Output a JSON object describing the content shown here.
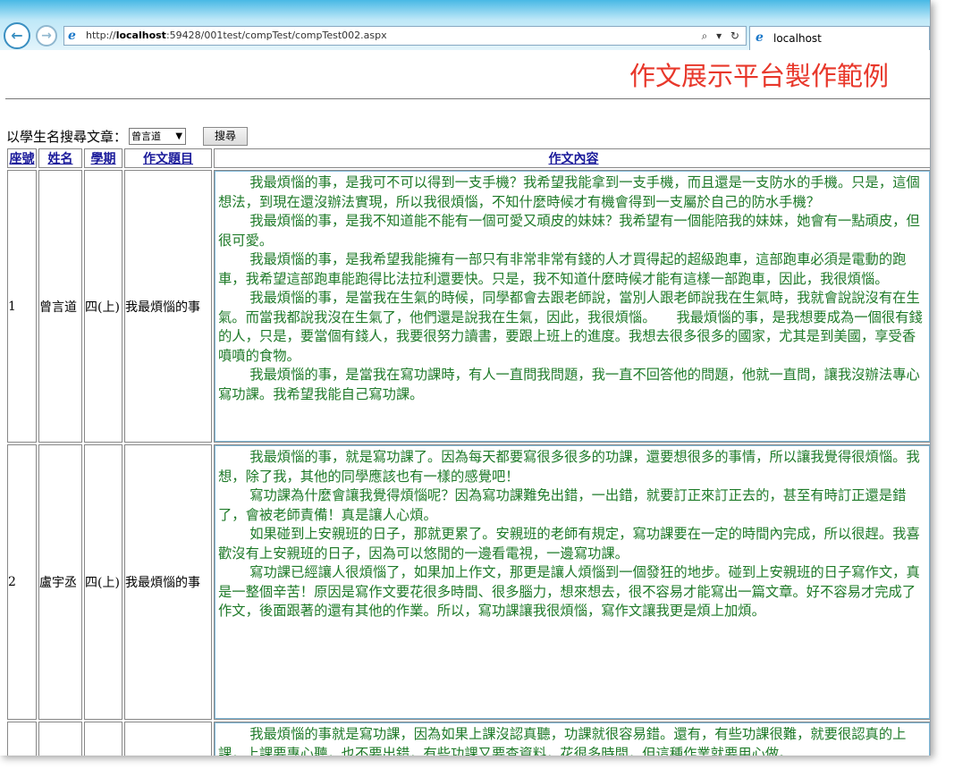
{
  "browser": {
    "url_prefix": "http://",
    "url_host": "localhost",
    "url_rest": ":59428/001test/compTest/compTest002.aspx",
    "address_tools": "⌕ ▾ ↻",
    "tab_title": "localhost",
    "back_glyph": "←",
    "forward_glyph": "→"
  },
  "page": {
    "title": "作文展示平台製作範例",
    "search_label": "以學生名搜尋文章：",
    "search_select_value": "曾言道",
    "search_button": "搜尋"
  },
  "table": {
    "headers": [
      "座號",
      "姓名",
      "學期",
      "作文題目",
      "作文內容"
    ],
    "rows": [
      {
        "seat": "1",
        "name": "曾言道",
        "term": "四(上)",
        "topic": "我最煩惱的事",
        "paragraphs": [
          "我最煩惱的事，是我可不可以得到一支手機？我希望我能拿到一支手機，而且還是一支防水的手機。只是，這個想法，到現在還沒辦法實現，所以我很煩惱，不知什麼時候才有機會得到一支屬於自己的防水手機？",
          "我最煩惱的事，是我不知道能不能有一個可愛又頑皮的妹妹？我希望有一個能陪我的妹妹，她會有一點頑皮，但很可愛。",
          "我最煩惱的事，是我希望我能擁有一部只有非常非常有錢的人才買得起的超級跑車，這部跑車必須是電動的跑車，我希望這部跑車能跑得比法拉利還要快。只是，我不知道什麼時候才能有這樣一部跑車，因此，我很煩惱。",
          "我最煩惱的事，是當我在生氣的時候，同學都會去跟老師說，當別人跟老師說我在生氣時，我就會說說沒有在生氣。而當我都說我沒在生氣了，他們還是說我在生氣，因此，我很煩惱。　　我最煩惱的事，是我想要成為一個很有錢的人，只是，要當個有錢人，我要很努力讀書，要跟上班上的進度。我想去很多很多的國家，尤其是到美國，享受香噴噴的食物。",
          "我最煩惱的事，是當我在寫功課時，有人一直問我問題，我一直不回答他的問題，他就一直問，讓我沒辦法專心寫功課。我希望我能自己寫功課。"
        ]
      },
      {
        "seat": "2",
        "name": "盧宇丞",
        "term": "四(上)",
        "topic": "我最煩惱的事",
        "paragraphs": [
          "我最煩惱的事，就是寫功課了。因為每天都要寫很多很多的功課，還要想很多的事情，所以讓我覺得很煩惱。我想，除了我，其他的同學應該也有一樣的感覺吧！",
          "寫功課為什麼會讓我覺得煩惱呢？因為寫功課難免出錯，一出錯，就要訂正來訂正去的，甚至有時訂正還是錯了，會被老師責備！真是讓人心煩。",
          "如果碰到上安親班的日子，那就更累了。安親班的老師有規定，寫功課要在一定的時間內完成，所以很趕。我喜歡沒有上安親班的日子，因為可以悠閒的一邊看電視，一邊寫功課。",
          "寫功課已經讓人很煩惱了，如果加上作文，那更是讓人煩惱到一個發狂的地步。碰到上安親班的日子寫作文，真是一整個辛苦！原因是寫作文要花很多時間、很多腦力，想來想去，很不容易才能寫出一篇文章。好不容易才完成了作文，後面跟著的還有其他的作業。所以，寫功課讓我很煩惱，寫作文讓我更是煩上加煩。"
        ]
      },
      {
        "seat": "",
        "name": "",
        "term": "",
        "topic": "",
        "paragraphs": [
          "我最煩惱的事就是寫功課，因為如果上課沒認真聽，功課就很容易錯。還有，有些功課很難，就要很認真的上課，上課要專心聽，也不要出錯，有些功課又要查資料，花很多時間，但這種作業就要用心做。"
        ]
      }
    ]
  },
  "colors": {
    "title": "#e8372a",
    "essay_text": "#1e7a28",
    "header_link": "#1a1a9a",
    "toolbar": "#48b9e5"
  }
}
